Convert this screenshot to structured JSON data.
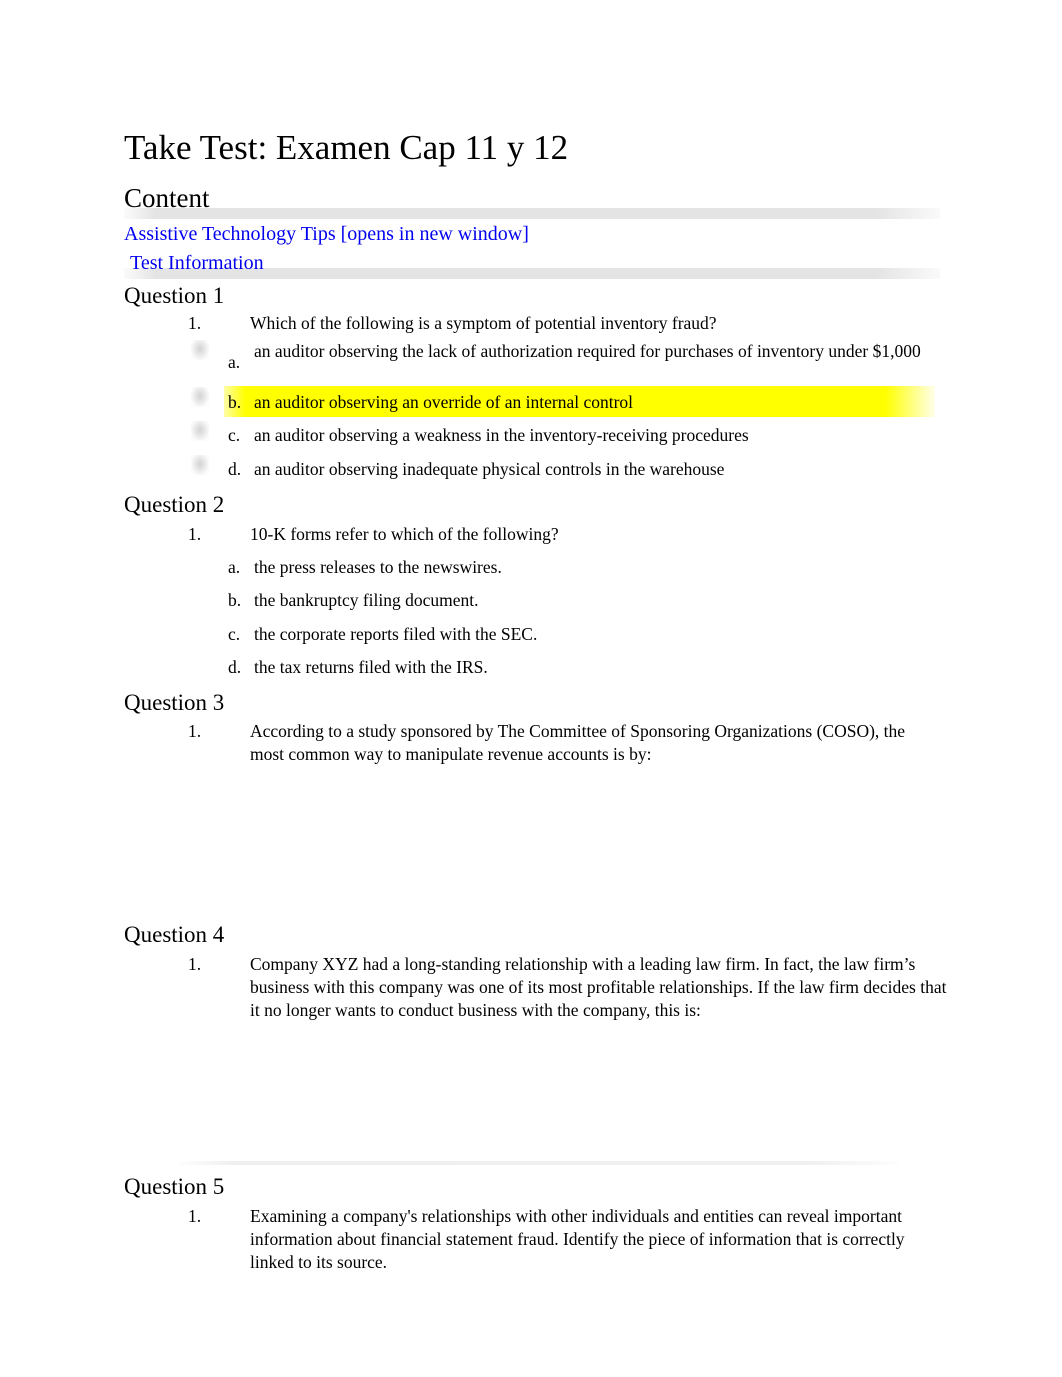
{
  "document": {
    "title": "Take Test: Examen Cap 11 y 12",
    "content_heading": "Content"
  },
  "links": {
    "assistive_tips": "Assistive Technology Tips [opens in new window]",
    "test_information": "Test Information",
    "link_color": "#0000EE"
  },
  "highlight": {
    "color": "#FFFF00"
  },
  "questions": [
    {
      "heading": "Question 1",
      "number_marker": "1.",
      "stem": "Which of the following is a symptom of potential inventory fraud?",
      "options": [
        {
          "letter": "a.",
          "text": "an auditor observing the lack of authorization required for purchases of inventory under $1,000",
          "highlighted": false,
          "has_radio": true
        },
        {
          "letter": "b.",
          "text": "an auditor observing an override of an internal control",
          "highlighted": true,
          "has_radio": true
        },
        {
          "letter": "c.",
          "text": "an auditor observing a weakness in the inventory-receiving procedures",
          "highlighted": false,
          "has_radio": true
        },
        {
          "letter": "d.",
          "text": "an auditor observing inadequate physical controls in the warehouse",
          "highlighted": false,
          "has_radio": true
        }
      ]
    },
    {
      "heading": "Question 2",
      "number_marker": "1.",
      "stem": "10-K forms refer to which of the following?",
      "options": [
        {
          "letter": "a.",
          "text": "the press releases to the newswires.",
          "highlighted": false,
          "has_radio": false
        },
        {
          "letter": "b.",
          "text": "the bankruptcy filing document.",
          "highlighted": false,
          "has_radio": false
        },
        {
          "letter": "c.",
          "text": "the corporate reports filed with the SEC.",
          "highlighted": false,
          "has_radio": false
        },
        {
          "letter": "d.",
          "text": "the tax returns filed with the IRS.",
          "highlighted": false,
          "has_radio": false
        }
      ]
    },
    {
      "heading": "Question 3",
      "number_marker": "1.",
      "stem": "According to a study sponsored by The Committee of Sponsoring Organizations (COSO), the most common way to manipulate revenue accounts is by:",
      "options": []
    },
    {
      "heading": "Question 4",
      "number_marker": "1.",
      "stem": "Company XYZ had a long-standing relationship with a leading law firm. In fact, the law firm’s business with this company was one of its most profitable relationships. If the law firm decides that it no longer wants to conduct business with the company, this is:",
      "options": []
    },
    {
      "heading": "Question 5",
      "number_marker": "1.",
      "stem": "Examining a company's relationships with other individuals and entities can reveal important information about financial statement fraud. Identify the piece of information that is correctly linked to its source.",
      "options": []
    }
  ]
}
